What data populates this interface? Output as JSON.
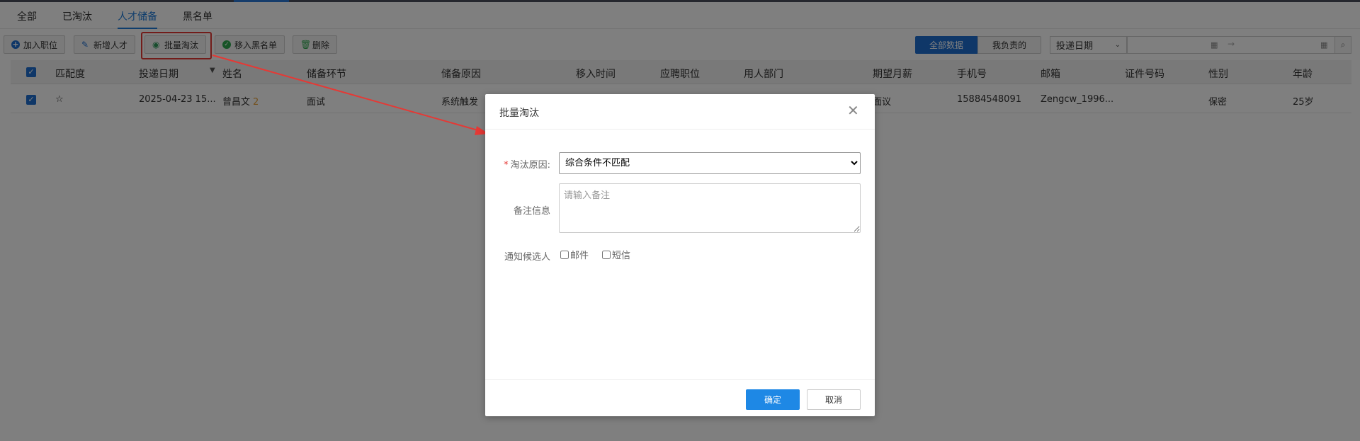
{
  "tabs": [
    {
      "label": "全部"
    },
    {
      "label": "已淘汰"
    },
    {
      "label": "人才储备",
      "active": true
    },
    {
      "label": "黑名单"
    }
  ],
  "toolbar": {
    "add_position": "加入职位",
    "new_talent": "新增人才",
    "batch_eliminate": "批量淘汰",
    "move_blacklist": "移入黑名单",
    "delete": "删除"
  },
  "filters": {
    "all_data": "全部数据",
    "mine": "我负责的",
    "date_type": "投递日期"
  },
  "table": {
    "headers": [
      "匹配度",
      "投递日期",
      "姓名",
      "储备环节",
      "储备原因",
      "移入时间",
      "应聘职位",
      "用人部门",
      "期望月薪",
      "手机号",
      "邮箱",
      "证件号码",
      "性别",
      "年龄"
    ],
    "rows": [
      {
        "match": "☆",
        "date": "2025-04-23 15...",
        "name": "曾昌文",
        "name_count": "2",
        "stage": "面试",
        "reason": "系统触发",
        "moved_time": "",
        "position": "",
        "department": "",
        "salary": "面议",
        "phone": "15884548091",
        "email": "Zengcw_1996...",
        "id_no": "",
        "gender": "保密",
        "age": "25岁"
      }
    ]
  },
  "modal": {
    "title": "批量淘汰",
    "reason_label": "淘汰原因:",
    "reason_value": "综合条件不匹配",
    "remark_label": "备注信息",
    "remark_placeholder": "请输入备注",
    "notify_label": "通知候选人",
    "notify_email": "邮件",
    "notify_sms": "短信",
    "confirm": "确定",
    "cancel": "取消"
  },
  "colors": {
    "primary": "#1e6fd0",
    "highlight": "#e53935",
    "overlay": "rgba(0,0,0,0.5)"
  }
}
